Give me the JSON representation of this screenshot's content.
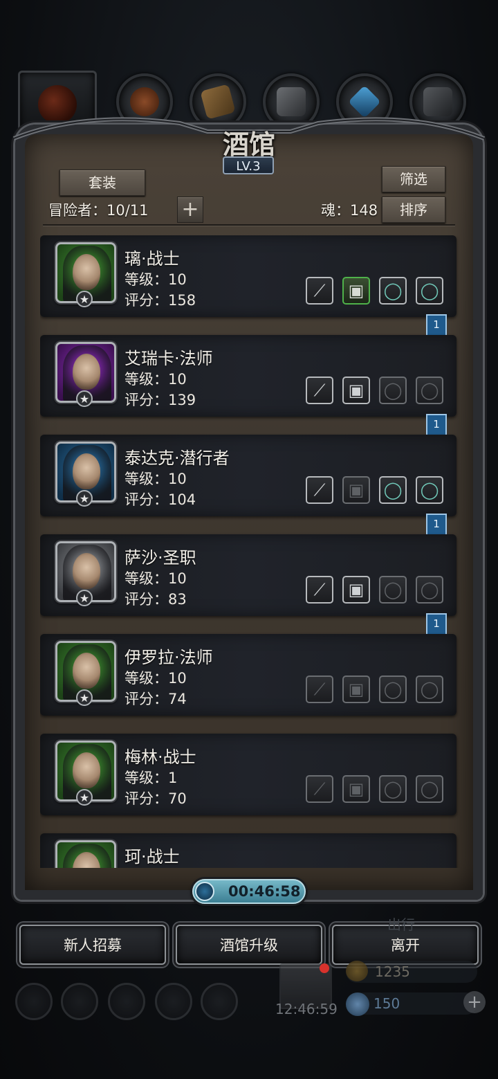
{
  "colors": {
    "accent_green": "#4fb24a",
    "accent_purple": "#8a2fb8",
    "accent_blue": "#2c6c9c",
    "timer": "#76b8c8"
  },
  "top_tabs": [
    {
      "icon": "hero-silhouette-icon",
      "active": true
    },
    {
      "icon": "potion-pouch-icon",
      "active": false
    },
    {
      "icon": "wooden-planks-icon",
      "active": false
    },
    {
      "icon": "iron-ingot-icon",
      "active": false
    },
    {
      "icon": "blue-crystal-icon",
      "active": false
    },
    {
      "icon": "anvil-icon",
      "active": false
    }
  ],
  "panel": {
    "title": "酒馆",
    "level": "LV.3",
    "set_button": "套装",
    "filter_button": "筛选",
    "sort_button": "排序",
    "adventurers_label": "冒险者：10/11",
    "plus": "+",
    "souls_label": "魂：148"
  },
  "heroes": [
    {
      "name": "璃·战士",
      "level": "等级：10",
      "score": "评分：158",
      "frame": "green",
      "star": "★",
      "bookmark": "1",
      "slots": [
        {
          "icon": "sword-icon",
          "state": "filled"
        },
        {
          "icon": "armor-icon",
          "state": "green"
        },
        {
          "icon": "ring-icon",
          "state": "ring"
        },
        {
          "icon": "ring-icon",
          "state": "ring"
        }
      ]
    },
    {
      "name": "艾瑞卡·法师",
      "level": "等级：10",
      "score": "评分：139",
      "frame": "purple",
      "star": "★",
      "bookmark": "1",
      "slots": [
        {
          "icon": "staff-icon",
          "state": "filled"
        },
        {
          "icon": "robe-icon",
          "state": "filled"
        },
        {
          "icon": "ring-icon",
          "state": "empty"
        },
        {
          "icon": "ring-icon",
          "state": "empty"
        }
      ]
    },
    {
      "name": "泰达克·潜行者",
      "level": "等级：10",
      "score": "评分：104",
      "frame": "blue",
      "star": "★",
      "bookmark": "1",
      "slots": [
        {
          "icon": "dagger-icon",
          "state": "filled"
        },
        {
          "icon": "armor-icon",
          "state": "empty"
        },
        {
          "icon": "ring-icon",
          "state": "ring"
        },
        {
          "icon": "ring-icon",
          "state": "ring"
        }
      ]
    },
    {
      "name": "萨沙·圣职",
      "level": "等级：10",
      "score": "评分：83",
      "frame": "gray",
      "star": "★",
      "bookmark": "1",
      "slots": [
        {
          "icon": "hammer-icon",
          "state": "filled"
        },
        {
          "icon": "armor-icon",
          "state": "filled"
        },
        {
          "icon": "ring-icon",
          "state": "empty"
        },
        {
          "icon": "ring-icon",
          "state": "empty"
        }
      ]
    },
    {
      "name": "伊罗拉·法师",
      "level": "等级：10",
      "score": "评分：74",
      "frame": "green",
      "star": "★",
      "bookmark": "",
      "slots": [
        {
          "icon": "staff-icon",
          "state": "empty"
        },
        {
          "icon": "armor-icon",
          "state": "empty"
        },
        {
          "icon": "ring-icon",
          "state": "empty"
        },
        {
          "icon": "ring-icon",
          "state": "empty"
        }
      ]
    },
    {
      "name": "梅林·战士",
      "level": "等级：1",
      "score": "评分：70",
      "frame": "green",
      "star": "★",
      "bookmark": "",
      "slots": [
        {
          "icon": "sword-icon",
          "state": "empty"
        },
        {
          "icon": "armor-icon",
          "state": "empty"
        },
        {
          "icon": "ring-icon",
          "state": "empty"
        },
        {
          "icon": "ring-icon",
          "state": "empty"
        }
      ]
    },
    {
      "name": "珂·战士",
      "level": "",
      "score": "",
      "frame": "green",
      "star": "",
      "bookmark": "",
      "slots": []
    }
  ],
  "timer": "00:46:58",
  "buttons": {
    "recruit": "新人招募",
    "upgrade": "酒馆升级",
    "leave": "离开"
  },
  "background_hud": {
    "clock": "12:46:59",
    "gold": "1235",
    "gems": "150",
    "faded_label": "出行"
  }
}
